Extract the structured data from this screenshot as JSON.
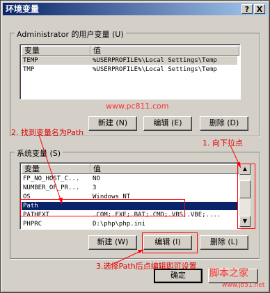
{
  "window": {
    "title": "环境变量",
    "help": "?",
    "close": "X"
  },
  "user_vars": {
    "legend": "Administrator 的用户变量 (U)",
    "columns": [
      "变量",
      "值"
    ],
    "rows": [
      {
        "name": "TEMP",
        "value": "%USERPROFILE%\\Local Settings\\Temp"
      },
      {
        "name": "TMP",
        "value": "%USERPROFILE%\\Local Settings\\Temp"
      }
    ],
    "buttons": {
      "new": "新建 (N)",
      "edit": "编辑 (E)",
      "delete": "删除 (D)"
    }
  },
  "system_vars": {
    "legend": "系统变量 (S)",
    "columns": [
      "变量",
      "值"
    ],
    "rows": [
      {
        "name": "FP_NO_HOST_C...",
        "value": "NO"
      },
      {
        "name": "NUMBER_OF_PR...",
        "value": "3"
      },
      {
        "name": "OS",
        "value": "Windows_NT"
      },
      {
        "name": "Path",
        "value": ""
      },
      {
        "name": "PATHEXT",
        "value": ".COM;.EXE;.BAT;.CMD;.VBS;.VBE;...."
      },
      {
        "name": "PHPRC",
        "value": "D:\\php\\php.ini"
      }
    ],
    "buttons": {
      "new": "新建 (W)",
      "edit": "编辑 (I)",
      "delete": "删除 (L)"
    }
  },
  "footer": {
    "ok": "确定"
  },
  "annotations": {
    "watermark": "www.pc811.com",
    "step1": "1. 向下拉点",
    "step2": "2. 找到变量名为Path",
    "step3": "3.选择Path后点编辑即可设置",
    "brand": "脚本之家",
    "brand_url": "www.jb51.net"
  }
}
